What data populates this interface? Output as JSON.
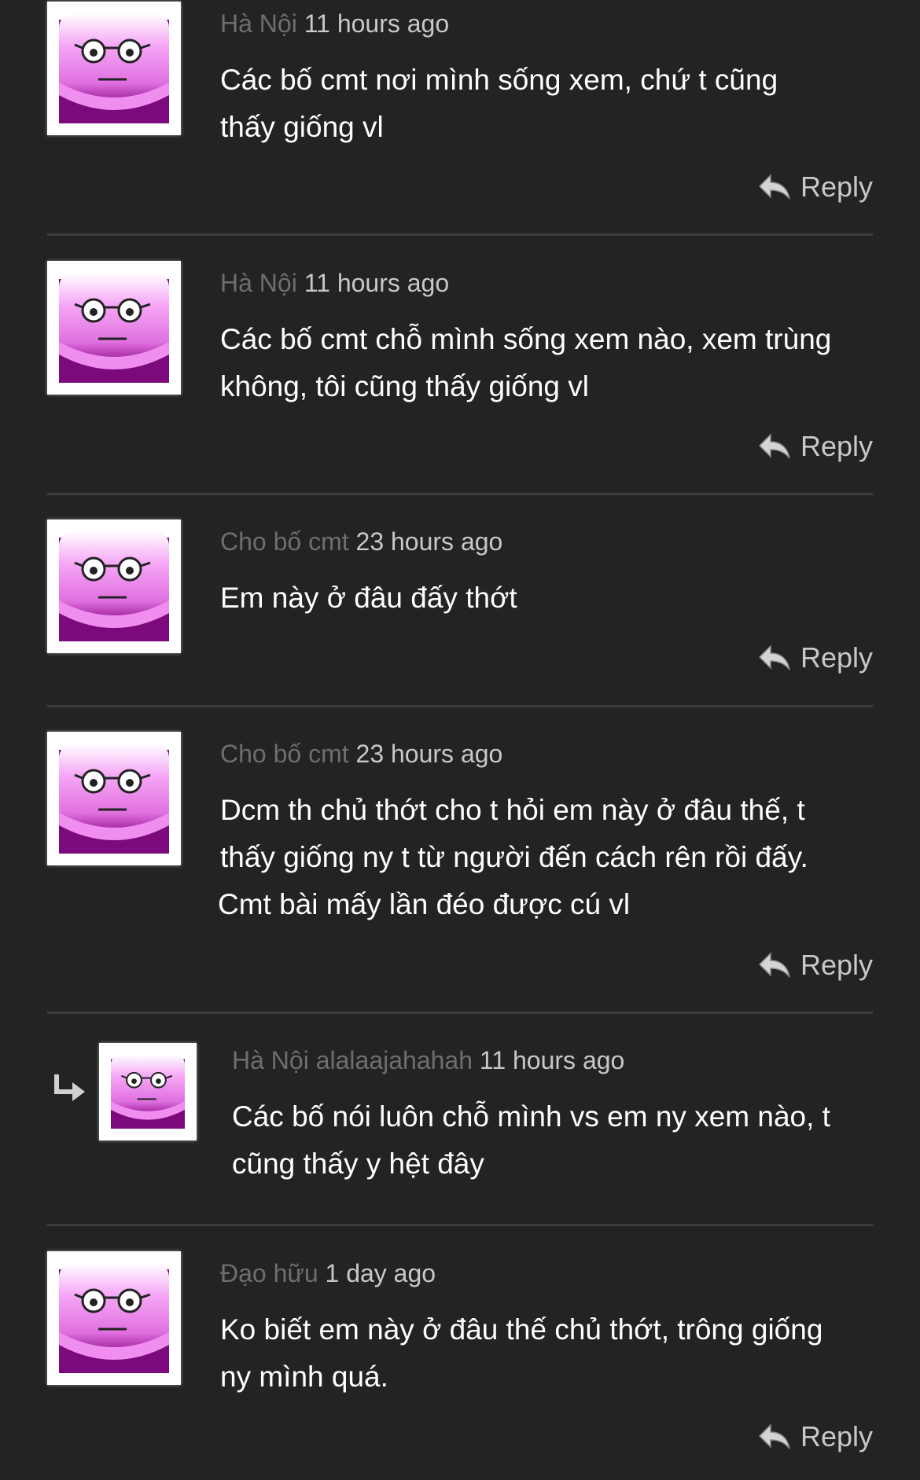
{
  "colors": {
    "background": "#232323",
    "author": "#6e6e6e",
    "time": "#c8c8c8",
    "avatar": "#f28ef2"
  },
  "reply_label": "Reply",
  "comments": [
    {
      "author": "Hà Nội",
      "time": "11 hours ago",
      "text": [
        "Các bố cmt nơi mình sống xem, chứ t cũng",
        "thấy giống vl"
      ]
    },
    {
      "author": "Hà Nội",
      "time": "11 hours ago",
      "text": [
        "Các bố cmt chỗ mình sống xem nào, xem trùng",
        "không, tôi cũng thấy giống vl"
      ]
    },
    {
      "author": "Cho bố cmt",
      "time": "23 hours ago",
      "text": [
        "Em này ở đâu đấy thớt"
      ]
    },
    {
      "author": "Cho bố cmt",
      "time": "23 hours ago",
      "text": [
        "Dcm th chủ thớt cho t hỏi em này ở đâu thế, t",
        "thấy giống ny t từ người đến cách rên rồi đấy.",
        "Cmt bài mấy lần đéo được cú vl"
      ]
    },
    {
      "author": "Hà Nội alalaajahahah",
      "time": "11 hours ago",
      "text": [
        "Các bố nói luôn chỗ mình vs em ny xem nào, t",
        "cũng thấy y hệt đây"
      ]
    },
    {
      "author": "Đạo hữu",
      "time": "1 day ago",
      "text": [
        "Ko biết em này ở đâu thế chủ thớt, trông giống",
        "ny mình quá."
      ]
    }
  ]
}
